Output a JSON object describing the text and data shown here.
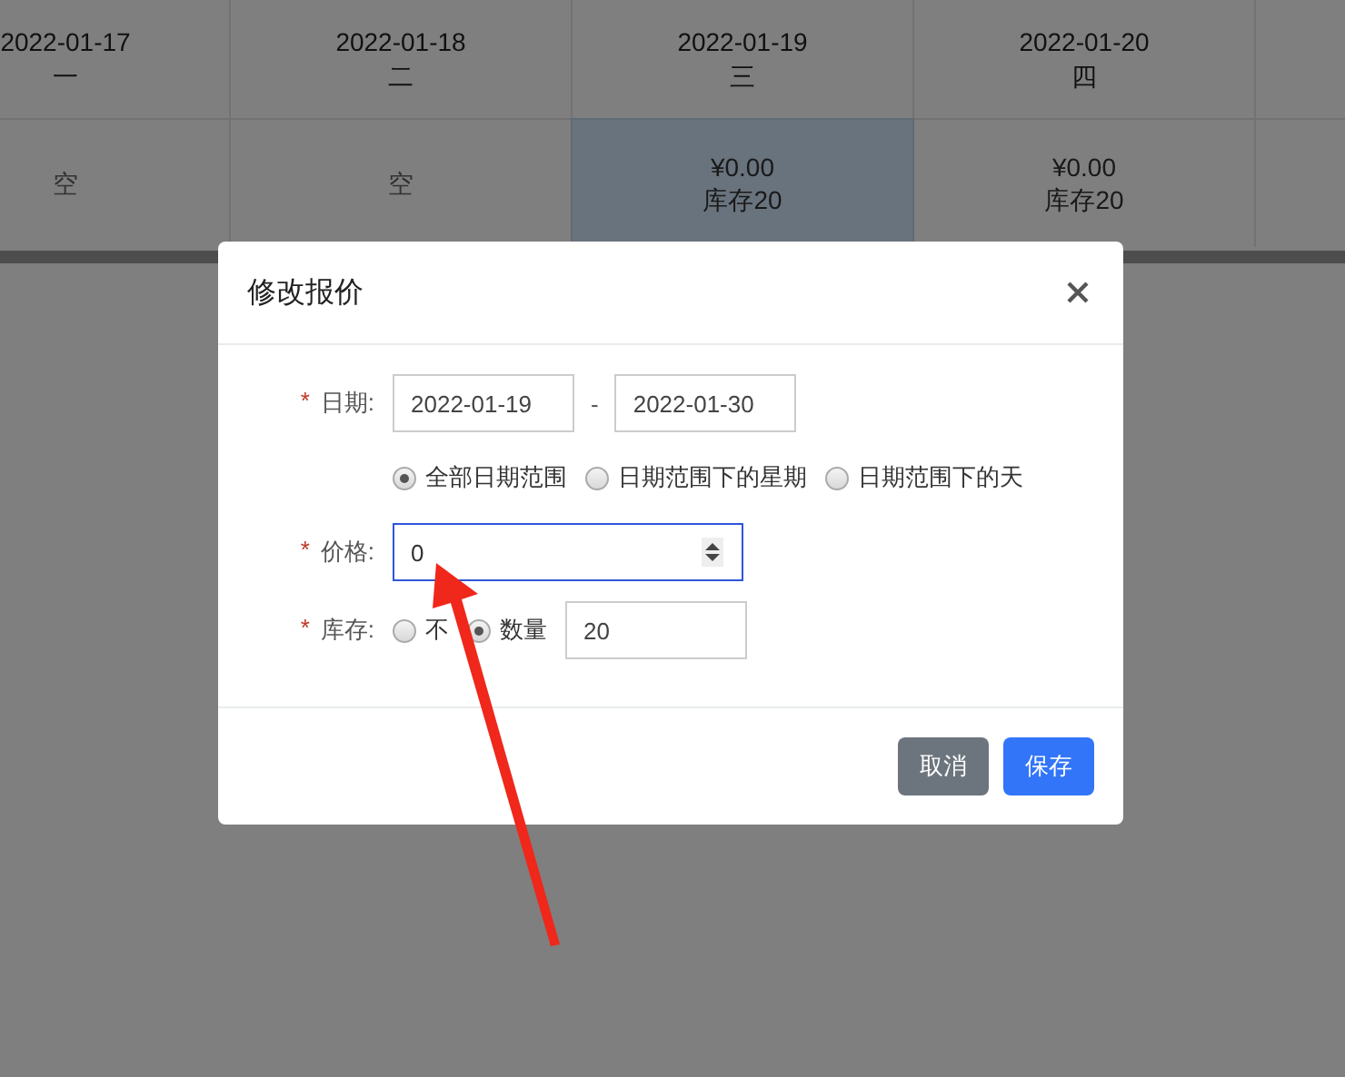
{
  "calendar": {
    "columns": [
      {
        "date": "2022-01-17",
        "weekday": "一",
        "kind": "empty",
        "lines": [
          "空"
        ],
        "selected": false
      },
      {
        "date": "2022-01-18",
        "weekday": "二",
        "kind": "empty",
        "lines": [
          "空"
        ],
        "selected": false
      },
      {
        "date": "2022-01-19",
        "weekday": "三",
        "kind": "priced",
        "lines": [
          "¥0.00",
          "库存20"
        ],
        "selected": true
      },
      {
        "date": "2022-01-20",
        "weekday": "四",
        "kind": "priced",
        "lines": [
          "¥0.00",
          "库存20"
        ],
        "selected": false
      }
    ]
  },
  "dialog": {
    "title": "修改报价",
    "date": {
      "required_mark": "*",
      "label": "日期:",
      "start": "2022-01-19",
      "separator": "-",
      "end": "2022-01-30"
    },
    "range_options": [
      {
        "label": "全部日期范围",
        "selected": true
      },
      {
        "label": "日期范围下的星期",
        "selected": false
      },
      {
        "label": "日期范围下的天",
        "selected": false
      }
    ],
    "price": {
      "required_mark": "*",
      "label": "价格:",
      "value": "0",
      "focused": true
    },
    "stock": {
      "required_mark": "*",
      "label": "库存:",
      "options": [
        {
          "label": "不",
          "selected": false
        },
        {
          "label": "数量",
          "selected": true
        }
      ],
      "value": "20"
    },
    "buttons": [
      {
        "label": "取消",
        "kind": "secondary"
      },
      {
        "label": "保存",
        "kind": "primary"
      }
    ]
  }
}
